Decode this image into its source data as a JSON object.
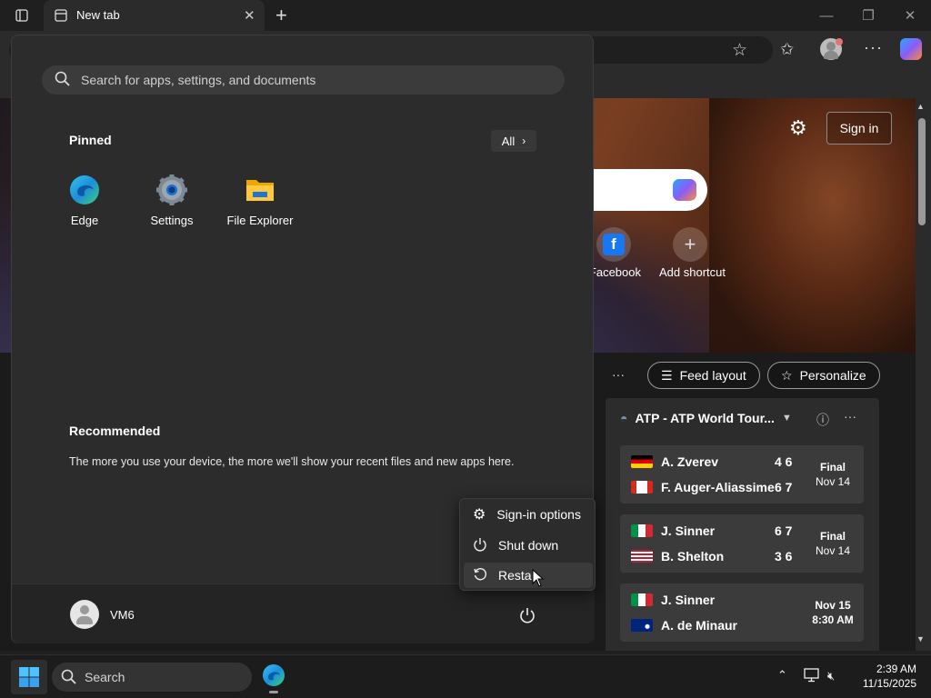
{
  "browser": {
    "tab_title": "New tab",
    "profile_color": "#c8c8c8"
  },
  "newtab": {
    "signin_label": "Sign in",
    "shortcuts": [
      {
        "label": "Facebook"
      },
      {
        "label": "Add shortcut"
      }
    ],
    "feed_layout_label": "Feed layout",
    "personalize_label": "Personalize",
    "more_glyph": "···"
  },
  "feed": {
    "title": "ATP - ATP World Tour...",
    "matches": [
      {
        "p1": "A. Zverev",
        "p1_score": "4 6",
        "p2": "F. Auger-Aliassime",
        "p2_score": "6 7",
        "status": "Final",
        "date": "Nov 14",
        "p1_flag": "germany",
        "p2_flag": "canada"
      },
      {
        "p1": "J. Sinner",
        "p1_score": "6 7",
        "p2": "B. Shelton",
        "p2_score": "3 6",
        "status": "Final",
        "date": "Nov 14",
        "p1_flag": "italy",
        "p2_flag": "usa"
      },
      {
        "p1": "J. Sinner",
        "p1_score": "",
        "p2": "A. de Minaur",
        "p2_score": "",
        "status": "Nov 15",
        "date": "8:30 AM",
        "p1_flag": "italy",
        "p2_flag": "australia"
      }
    ]
  },
  "start_menu": {
    "search_placeholder": "Search for apps, settings, and documents",
    "pinned_title": "Pinned",
    "all_label": "All",
    "pinned_apps": [
      {
        "label": "Edge",
        "icon": "edge-icon"
      },
      {
        "label": "Settings",
        "icon": "settings-gear-icon"
      },
      {
        "label": "File Explorer",
        "icon": "folder-icon"
      }
    ],
    "recommended_title": "Recommended",
    "recommended_text": "The more you use your device, the more we'll show your recent files and new apps here.",
    "user_name": "VM6",
    "power_menu": [
      {
        "label": "Sign-in options",
        "icon": "gear-icon"
      },
      {
        "label": "Shut down",
        "icon": "power-icon"
      },
      {
        "label": "Restart",
        "icon": "restart-icon"
      }
    ]
  },
  "taskbar": {
    "search_label": "Search",
    "time": "2:39 AM",
    "date": "11/15/2025"
  },
  "colors": {
    "accent": "#0078d4",
    "start_bg": "#2c2c2c",
    "taskbar_bg": "#1c1c1c"
  }
}
